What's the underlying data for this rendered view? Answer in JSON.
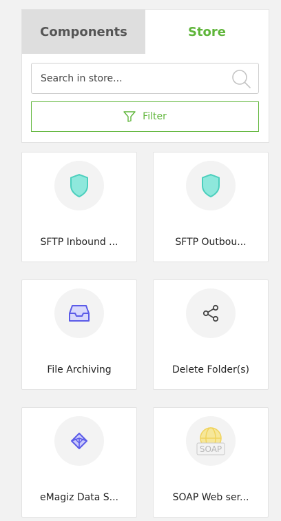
{
  "tabs": {
    "components": "Components",
    "store": "Store"
  },
  "search": {
    "placeholder": "Search in store..."
  },
  "filter": {
    "label": "Filter"
  },
  "colors": {
    "accent": "#5fb53a",
    "shield": "#7fe3d6",
    "blue_icon": "#5b5be8",
    "soap_yellow": "#f2d76b"
  },
  "cards": [
    {
      "label": "SFTP Inbound ...",
      "icon": "shield-icon"
    },
    {
      "label": "SFTP Outbou...",
      "icon": "shield-icon"
    },
    {
      "label": "File Archiving",
      "icon": "inbox-icon"
    },
    {
      "label": "Delete Folder(s)",
      "icon": "share-icon"
    },
    {
      "label": "eMagiz Data S...",
      "icon": "cube-icon"
    },
    {
      "label": "SOAP Web ser...",
      "icon": "soap-icon",
      "icon_text": "SOAP"
    }
  ]
}
